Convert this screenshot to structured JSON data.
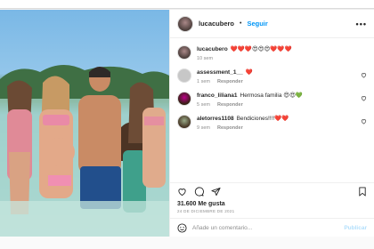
{
  "post": {
    "author": "lucacubero",
    "separator": "•",
    "follow_label": "Seguir",
    "more_label": "•••"
  },
  "caption": {
    "author": "lucacubero",
    "emojis": "❤️❤️❤️😍😍😍❤️❤️❤️",
    "time": "10 sem"
  },
  "comments": [
    {
      "user": "assessment_1__",
      "text": "❤️",
      "time": "1 sem",
      "reply": "Responder"
    },
    {
      "user": "franco_liliana1",
      "text": "Hermosa familia 😍😍💚",
      "time": "5 sem",
      "reply": "Responder"
    },
    {
      "user": "aletorres1108",
      "text": "Bendiciones!!!!❤️❤️",
      "time": "9 sem",
      "reply": "Responder"
    }
  ],
  "likes": "31.600 Me gusta",
  "date": "24 DE DICIEMBRE DE 2021",
  "composer": {
    "placeholder": "Añade un comentario...",
    "publish": "Publicar"
  },
  "colors": {
    "follow": "#0095f6",
    "heart": "#ed4956",
    "muted": "#8e8e8e"
  }
}
